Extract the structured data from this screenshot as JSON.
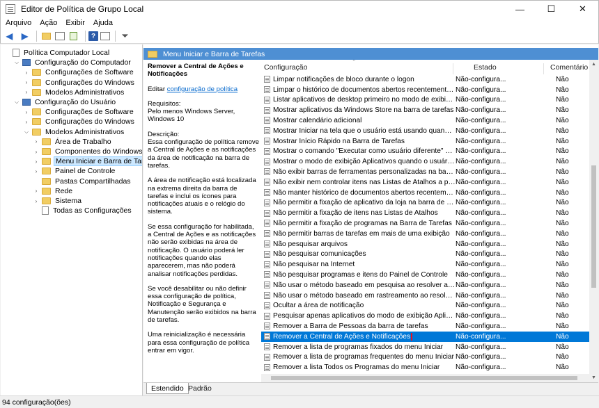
{
  "window": {
    "title": "Editor de Política de Grupo Local",
    "minimize": "—",
    "maximize": "☐",
    "close": "✕"
  },
  "menu": [
    "Arquivo",
    "Ação",
    "Exibir",
    "Ajuda"
  ],
  "toolbar": {
    "icons": [
      "back-arrow-icon",
      "forward-arrow-icon",
      "up-folder-icon",
      "show-hide-tree-icon",
      "export-list-icon",
      "help-icon",
      "properties-icon",
      "filter-icon"
    ]
  },
  "tree": {
    "items": [
      {
        "label": "Política Computador Local",
        "indent": 0,
        "expander": "",
        "icon": "policy"
      },
      {
        "label": "Configuração do Computador",
        "indent": 1,
        "expander": "⌵",
        "icon": "pc"
      },
      {
        "label": "Configurações de Software",
        "indent": 2,
        "expander": "›",
        "icon": "folder"
      },
      {
        "label": "Configurações do Windows",
        "indent": 2,
        "expander": "›",
        "icon": "folder"
      },
      {
        "label": "Modelos Administrativos",
        "indent": 2,
        "expander": "›",
        "icon": "folder"
      },
      {
        "label": "Configuração do Usuário",
        "indent": 1,
        "expander": "⌵",
        "icon": "pc"
      },
      {
        "label": "Configurações de Software",
        "indent": 2,
        "expander": "›",
        "icon": "folder"
      },
      {
        "label": "Configurações do Windows",
        "indent": 2,
        "expander": "›",
        "icon": "folder"
      },
      {
        "label": "Modelos Administrativos",
        "indent": 2,
        "expander": "⌵",
        "icon": "folder"
      },
      {
        "label": "Área de Trabalho",
        "indent": 3,
        "expander": "›",
        "icon": "folder"
      },
      {
        "label": "Componentes do Windows",
        "indent": 3,
        "expander": "›",
        "icon": "folder"
      },
      {
        "label": "Menu Iniciar e Barra de Tarefas",
        "indent": 3,
        "expander": "›",
        "icon": "folder",
        "selected": true
      },
      {
        "label": "Painel de Controle",
        "indent": 3,
        "expander": "›",
        "icon": "folder"
      },
      {
        "label": "Pastas Compartilhadas",
        "indent": 3,
        "expander": "",
        "icon": "folder"
      },
      {
        "label": "Rede",
        "indent": 3,
        "expander": "›",
        "icon": "folder"
      },
      {
        "label": "Sistema",
        "indent": 3,
        "expander": "›",
        "icon": "folder"
      },
      {
        "label": "Todas as Configurações",
        "indent": 3,
        "expander": "",
        "icon": "doc"
      }
    ]
  },
  "pane": {
    "header": "Menu Iniciar e Barra de Tarefas"
  },
  "description": {
    "title": "Remover a Central de Ações e Notificações",
    "edit_prefix": "Editar ",
    "edit_link": "configuração de política",
    "requirements": "Requisitos:\nPelo menos Windows Server, Windows 10",
    "desc1": "Descrição:\nEssa configuração de política remove a Central de Ações e as notificações da área de notificação na barra de tarefas.",
    "desc2": "A área de notificação está localizada na extrema direita da barra de tarefas e inclui os ícones para notificações atuais e o relógio do sistema.",
    "desc3": "Se essa configuração for habilitada, a Central de Ações e as notificações não serão exibidas na área de notificação. O usuário poderá ler notificações quando elas aparecerem, mas não poderá analisar notificações perdidas.",
    "desc4": "Se você desabilitar ou não definir essa configuração de política, Notificação e Segurança e Manutenção serão exibidos na barra de tarefas.",
    "desc5": "Uma reinicialização é necessária para essa configuração de política entrar em vigor."
  },
  "list": {
    "columns": {
      "setting": "Configuração",
      "state": "Estado",
      "comment": "Comentário"
    },
    "rows": [
      {
        "name": "Limpar notificações de bloco durante o logon",
        "state": "Não-configura...",
        "comment": "Não"
      },
      {
        "name": "Limpar o histórico de documentos abertos recentemente ao...",
        "state": "Não-configura...",
        "comment": "Não"
      },
      {
        "name": "Listar aplicativos de desktop primeiro no modo de exibição ...",
        "state": "Não-configura...",
        "comment": "Não"
      },
      {
        "name": "Mostrar aplicativos da Windows Store na barra de tarefas",
        "state": "Não-configura...",
        "comment": "Não"
      },
      {
        "name": "Mostrar calendário adicional",
        "state": "Não-configura...",
        "comment": "Não"
      },
      {
        "name": "Mostrar Iniciar na tela que o usuário está usando quando ele...",
        "state": "Não-configura...",
        "comment": "Não"
      },
      {
        "name": "Mostrar Início Rápido na Barra de Tarefas",
        "state": "Não-configura...",
        "comment": "Não"
      },
      {
        "name": "Mostrar o comando \"Executar como usuário diferente\" em I...",
        "state": "Não-configura...",
        "comment": "Não"
      },
      {
        "name": "Mostrar o modo de exibição Aplicativos quando o usuário f...",
        "state": "Não-configura...",
        "comment": "Não"
      },
      {
        "name": "Não exibir barras de ferramentas personalizadas na barra de ...",
        "state": "Não-configura...",
        "comment": "Não"
      },
      {
        "name": "Não exibir nem controlar itens nas Listas de Atalhos a partir ...",
        "state": "Não-configura...",
        "comment": "Não"
      },
      {
        "name": "Não manter histórico de documentos abertos recentemente",
        "state": "Não-configura...",
        "comment": "Não"
      },
      {
        "name": "Não permitir a fixação de aplicativo da loja na barra de tarefas",
        "state": "Não-configura...",
        "comment": "Não"
      },
      {
        "name": "Não permitir a fixação de itens nas Listas de Atalhos",
        "state": "Não-configura...",
        "comment": "Não"
      },
      {
        "name": "Não permitir a fixação de programas na Barra de Tarefas",
        "state": "Não-configura...",
        "comment": "Não"
      },
      {
        "name": "Não permitir barras de tarefas em mais de uma exibição",
        "state": "Não-configura...",
        "comment": "Não"
      },
      {
        "name": "Não pesquisar arquivos",
        "state": "Não-configura...",
        "comment": "Não"
      },
      {
        "name": "Não pesquisar comunicações",
        "state": "Não-configura...",
        "comment": "Não"
      },
      {
        "name": "Não pesquisar na Internet",
        "state": "Não-configura...",
        "comment": "Não"
      },
      {
        "name": "Não pesquisar programas e itens do Painel de Controle",
        "state": "Não-configura...",
        "comment": "Não"
      },
      {
        "name": "Não usar o método baseado em pesquisa ao resolver atalho...",
        "state": "Não-configura...",
        "comment": "Não"
      },
      {
        "name": "Não usar o método baseado em rastreamento ao resolver at...",
        "state": "Não-configura...",
        "comment": "Não"
      },
      {
        "name": "Ocultar a área de notificação",
        "state": "Não-configura...",
        "comment": "Não"
      },
      {
        "name": "Pesquisar apenas aplicativos do modo de exibição Aplicativos",
        "state": "Não-configura...",
        "comment": "Não"
      },
      {
        "name": "Remover a Barra de Pessoas da barra de tarefas",
        "state": "Não-configura...",
        "comment": "Não"
      },
      {
        "name": "Remover a Central de Ações e Notificações",
        "state": "Não-configura...",
        "comment": "Não",
        "selected": true
      },
      {
        "name": "Remover a lista de programas fixados do menu Iniciar",
        "state": "Não-configura...",
        "comment": "Não"
      },
      {
        "name": "Remover a lista de programas frequentes do menu Iniciar",
        "state": "Não-configura...",
        "comment": "Não"
      },
      {
        "name": "Remover a lista Todos os Programas do menu Iniciar",
        "state": "Não-configura...",
        "comment": "Não"
      }
    ]
  },
  "tabs": {
    "extended": "Estendido",
    "standard": "Padrão"
  },
  "status": "94 configuração(ões)",
  "colors": {
    "selection": "#0078d7",
    "header": "#4e8fd3",
    "highlight_outline": "#e81123"
  }
}
